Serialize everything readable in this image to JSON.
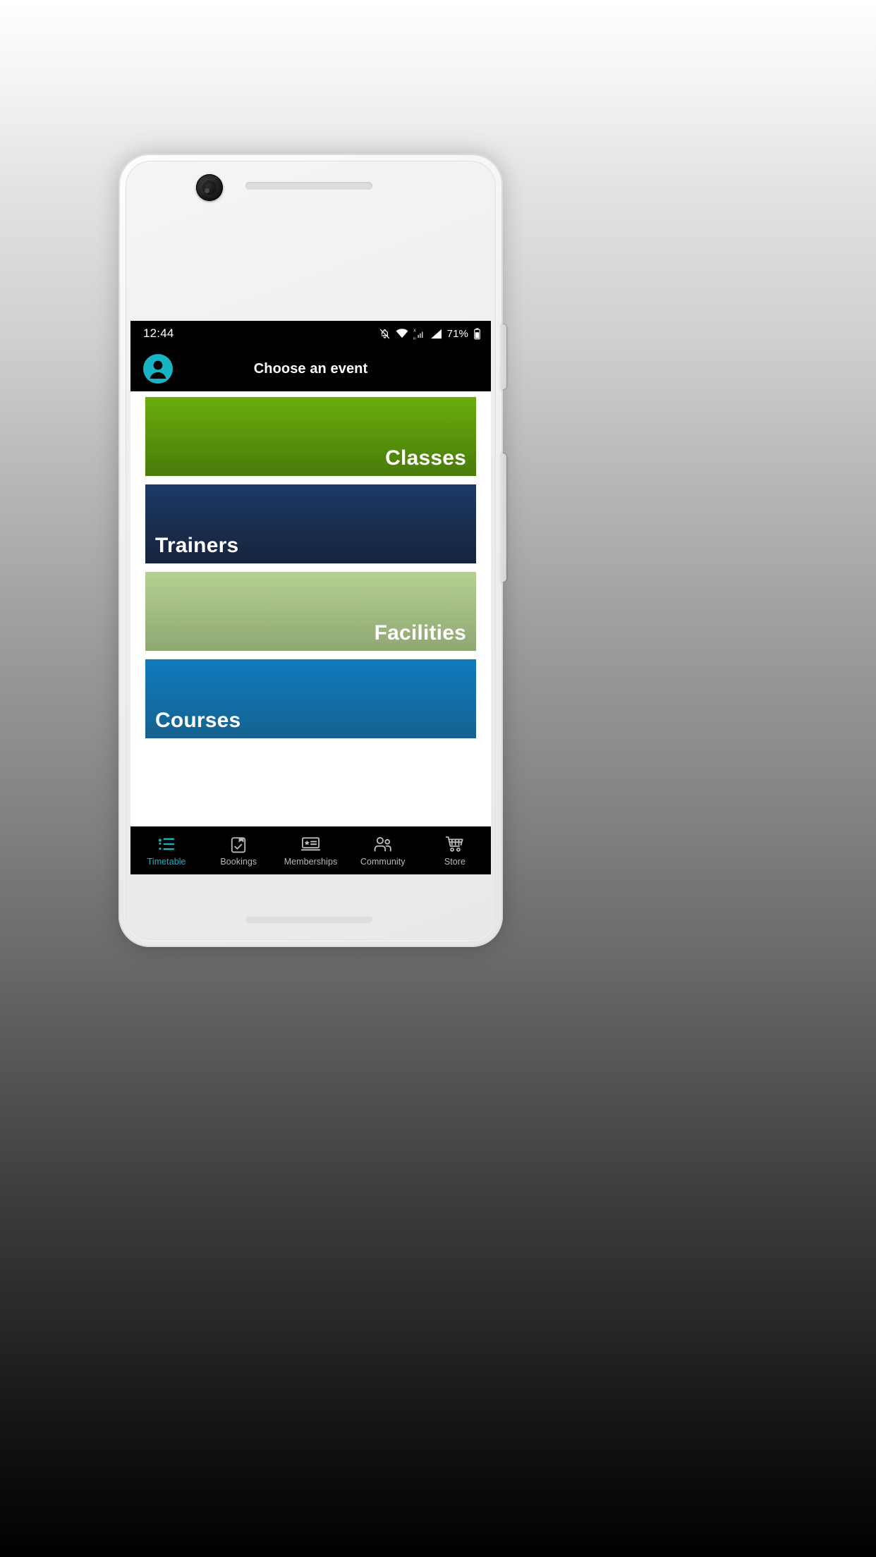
{
  "device": {
    "frame_color": "#efefef",
    "camera": "front-camera",
    "earpiece": "earpiece-speaker"
  },
  "statusbar": {
    "time": "12:44",
    "battery_percent": "71%",
    "icons": [
      "notifications-off-icon",
      "wifi-icon",
      "mobile-data-x-icon",
      "signal-bars-icon",
      "battery-icon"
    ]
  },
  "appbar": {
    "avatar": "user-avatar-icon",
    "avatar_color": "#17b5c4",
    "title": "Choose an event",
    "background": "#000000"
  },
  "cards": [
    {
      "label": "Classes",
      "align": "right",
      "gradient_from": "#6aad0c",
      "gradient_to": "#497b0a",
      "name": "card-classes"
    },
    {
      "label": "Trainers",
      "align": "left",
      "gradient_from": "#1c3a66",
      "gradient_to": "#151f36",
      "name": "card-trainers"
    },
    {
      "label": "Facilities",
      "align": "right",
      "gradient_from": "#b6cf92",
      "gradient_to": "#8fa872",
      "name": "card-facilities"
    },
    {
      "label": "Courses",
      "align": "left",
      "gradient_from": "#0f7bbd",
      "gradient_to": "#15628f",
      "name": "card-courses"
    }
  ],
  "bottom_nav": {
    "active_index": 0,
    "active_color": "#17b5c4",
    "inactive_color": "#b9b9b9",
    "items": [
      {
        "label": "Timetable",
        "icon": "list-timetable-icon"
      },
      {
        "label": "Bookings",
        "icon": "clipboard-check-icon"
      },
      {
        "label": "Memberships",
        "icon": "membership-card-icon"
      },
      {
        "label": "Community",
        "icon": "people-group-icon"
      },
      {
        "label": "Store",
        "icon": "shopping-cart-icon"
      }
    ]
  }
}
